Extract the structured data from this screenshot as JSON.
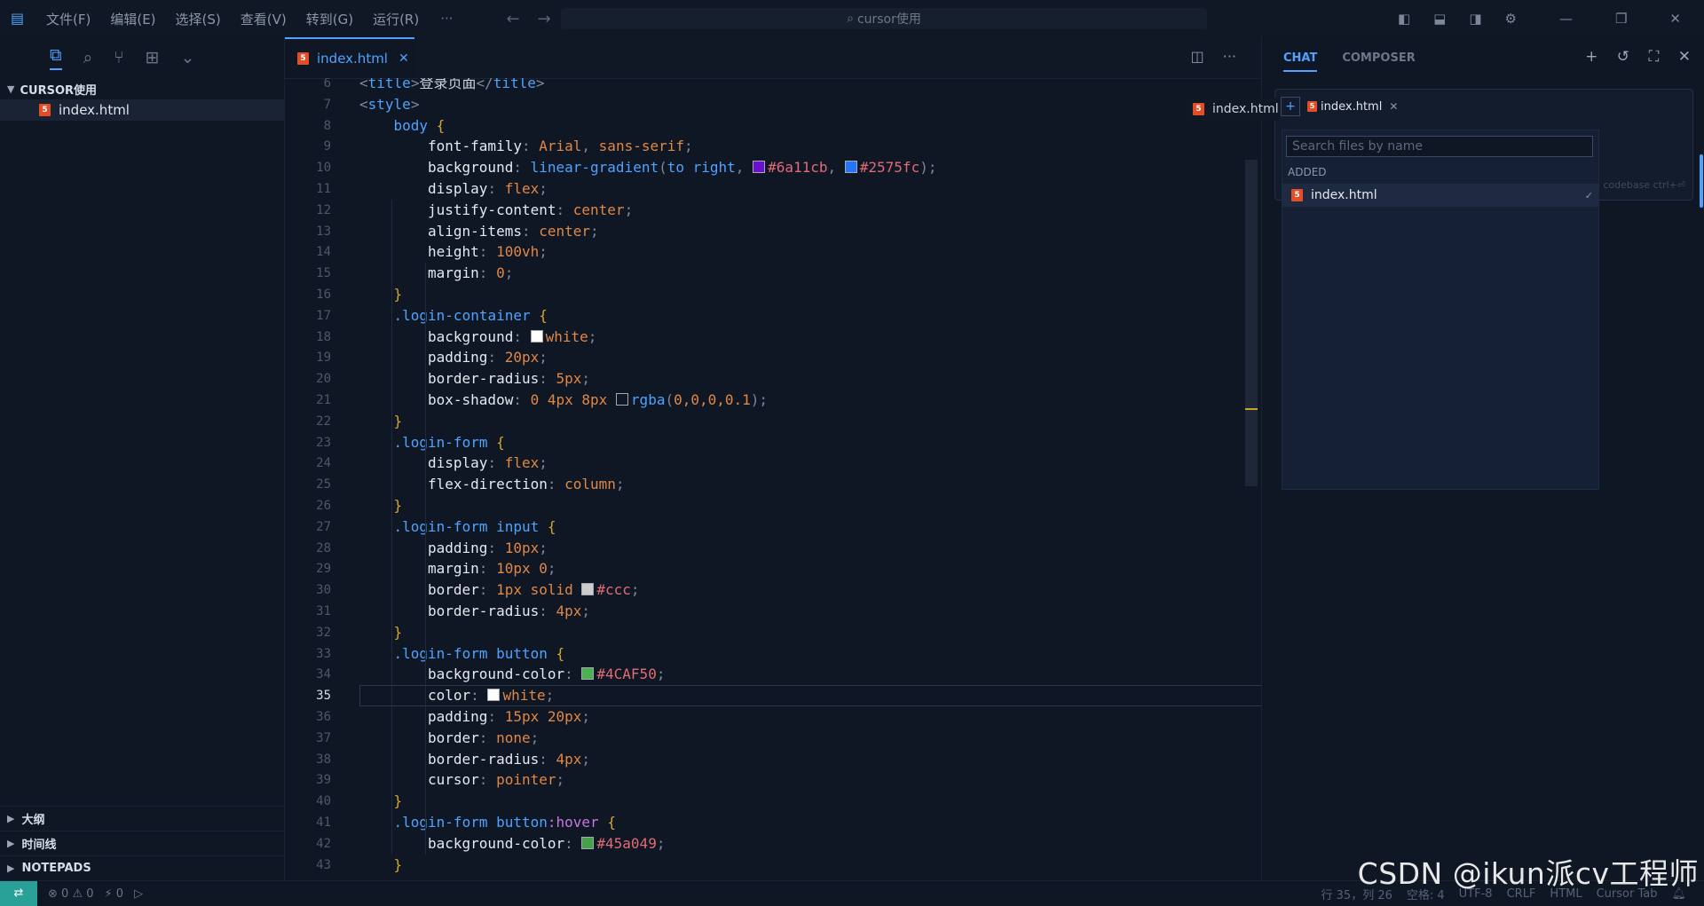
{
  "titlebar": {
    "menus": [
      "文件(F)",
      "编辑(E)",
      "选择(S)",
      "查看(V)",
      "转到(G)",
      "运行(R)"
    ],
    "more": "···",
    "search_text": "cursor使用"
  },
  "sidebar": {
    "folder": "CURSOR使用",
    "file": "index.html",
    "sections": [
      "大纲",
      "时间线",
      "NOTEPADS"
    ]
  },
  "editor": {
    "tab_label": "index.html",
    "current_line": 35
  },
  "code_lines": [
    {
      "n": "6",
      "parts": [
        [
          "tag",
          "<"
        ],
        [
          "tagname",
          "title"
        ],
        [
          "tag",
          ">"
        ],
        [
          "str",
          "登录页面"
        ],
        [
          "tag",
          "</"
        ],
        [
          "tagname",
          "title"
        ],
        [
          "tag",
          ">"
        ]
      ],
      "indent": 1
    },
    {
      "n": "7",
      "parts": [
        [
          "tag",
          "<"
        ],
        [
          "tagname",
          "style"
        ],
        [
          "tag",
          ">"
        ]
      ],
      "indent": 1
    },
    {
      "n": "8",
      "parts": [
        [
          "sel",
          "body"
        ],
        [
          "str",
          " "
        ],
        [
          "brace",
          "{"
        ]
      ],
      "indent": 2
    },
    {
      "n": "9",
      "parts": [
        [
          "prop",
          "font-family"
        ],
        [
          "punc",
          ": "
        ],
        [
          "val",
          "Arial"
        ],
        [
          "punc",
          ", "
        ],
        [
          "val",
          "sans-serif"
        ],
        [
          "punc",
          ";"
        ]
      ],
      "indent": 3
    },
    {
      "n": "10",
      "parts": [
        [
          "prop",
          "background"
        ],
        [
          "punc",
          ": "
        ],
        [
          "fn",
          "linear-gradient"
        ],
        [
          "punc",
          "("
        ],
        [
          "fn",
          "to right"
        ],
        [
          "punc",
          ", "
        ],
        [
          "swatch",
          "#6a11cb"
        ],
        [
          "hex",
          "#6a11cb"
        ],
        [
          "punc",
          ", "
        ],
        [
          "swatch",
          "#2575fc"
        ],
        [
          "hex",
          "#2575fc"
        ],
        [
          "punc",
          ");"
        ]
      ],
      "indent": 3
    },
    {
      "n": "11",
      "parts": [
        [
          "prop",
          "display"
        ],
        [
          "punc",
          ": "
        ],
        [
          "val",
          "flex"
        ],
        [
          "punc",
          ";"
        ]
      ],
      "indent": 3
    },
    {
      "n": "12",
      "parts": [
        [
          "prop",
          "justify-content"
        ],
        [
          "punc",
          ": "
        ],
        [
          "val",
          "center"
        ],
        [
          "punc",
          ";"
        ]
      ],
      "indent": 3
    },
    {
      "n": "13",
      "parts": [
        [
          "prop",
          "align-items"
        ],
        [
          "punc",
          ": "
        ],
        [
          "val",
          "center"
        ],
        [
          "punc",
          ";"
        ]
      ],
      "indent": 3
    },
    {
      "n": "14",
      "parts": [
        [
          "prop",
          "height"
        ],
        [
          "punc",
          ": "
        ],
        [
          "num",
          "100vh"
        ],
        [
          "punc",
          ";"
        ]
      ],
      "indent": 3
    },
    {
      "n": "15",
      "parts": [
        [
          "prop",
          "margin"
        ],
        [
          "punc",
          ": "
        ],
        [
          "num",
          "0"
        ],
        [
          "punc",
          ";"
        ]
      ],
      "indent": 3
    },
    {
      "n": "16",
      "parts": [
        [
          "brace",
          "}"
        ]
      ],
      "indent": 2
    },
    {
      "n": "17",
      "parts": [
        [
          "sel",
          ".login-container"
        ],
        [
          "str",
          " "
        ],
        [
          "brace",
          "{"
        ]
      ],
      "indent": 2
    },
    {
      "n": "18",
      "parts": [
        [
          "prop",
          "background"
        ],
        [
          "punc",
          ": "
        ],
        [
          "swatch",
          "#ffffff"
        ],
        [
          "val",
          "white"
        ],
        [
          "punc",
          ";"
        ]
      ],
      "indent": 3
    },
    {
      "n": "19",
      "parts": [
        [
          "prop",
          "padding"
        ],
        [
          "punc",
          ": "
        ],
        [
          "num",
          "20px"
        ],
        [
          "punc",
          ";"
        ]
      ],
      "indent": 3
    },
    {
      "n": "20",
      "parts": [
        [
          "prop",
          "border-radius"
        ],
        [
          "punc",
          ": "
        ],
        [
          "num",
          "5px"
        ],
        [
          "punc",
          ";"
        ]
      ],
      "indent": 3
    },
    {
      "n": "21",
      "parts": [
        [
          "prop",
          "box-shadow"
        ],
        [
          "punc",
          ": "
        ],
        [
          "num",
          "0 4px 8px "
        ],
        [
          "swatch",
          "#101826"
        ],
        [
          "fn",
          "rgba"
        ],
        [
          "punc",
          "("
        ],
        [
          "num",
          "0,0,0,0.1"
        ],
        [
          "punc",
          ");"
        ]
      ],
      "indent": 3
    },
    {
      "n": "22",
      "parts": [
        [
          "brace",
          "}"
        ]
      ],
      "indent": 2
    },
    {
      "n": "23",
      "parts": [
        [
          "sel",
          ".login-form"
        ],
        [
          "str",
          " "
        ],
        [
          "brace",
          "{"
        ]
      ],
      "indent": 2
    },
    {
      "n": "24",
      "parts": [
        [
          "prop",
          "display"
        ],
        [
          "punc",
          ": "
        ],
        [
          "val",
          "flex"
        ],
        [
          "punc",
          ";"
        ]
      ],
      "indent": 3
    },
    {
      "n": "25",
      "parts": [
        [
          "prop",
          "flex-direction"
        ],
        [
          "punc",
          ": "
        ],
        [
          "val",
          "column"
        ],
        [
          "punc",
          ";"
        ]
      ],
      "indent": 3
    },
    {
      "n": "26",
      "parts": [
        [
          "brace",
          "}"
        ]
      ],
      "indent": 2
    },
    {
      "n": "27",
      "parts": [
        [
          "sel",
          ".login-form input"
        ],
        [
          "str",
          " "
        ],
        [
          "brace",
          "{"
        ]
      ],
      "indent": 2
    },
    {
      "n": "28",
      "parts": [
        [
          "prop",
          "padding"
        ],
        [
          "punc",
          ": "
        ],
        [
          "num",
          "10px"
        ],
        [
          "punc",
          ";"
        ]
      ],
      "indent": 3
    },
    {
      "n": "29",
      "parts": [
        [
          "prop",
          "margin"
        ],
        [
          "punc",
          ": "
        ],
        [
          "num",
          "10px 0"
        ],
        [
          "punc",
          ";"
        ]
      ],
      "indent": 3
    },
    {
      "n": "30",
      "parts": [
        [
          "prop",
          "border"
        ],
        [
          "punc",
          ": "
        ],
        [
          "num",
          "1px solid "
        ],
        [
          "swatch",
          "#cccccc"
        ],
        [
          "hex",
          "#ccc"
        ],
        [
          "punc",
          ";"
        ]
      ],
      "indent": 3
    },
    {
      "n": "31",
      "parts": [
        [
          "prop",
          "border-radius"
        ],
        [
          "punc",
          ": "
        ],
        [
          "num",
          "4px"
        ],
        [
          "punc",
          ";"
        ]
      ],
      "indent": 3
    },
    {
      "n": "32",
      "parts": [
        [
          "brace",
          "}"
        ]
      ],
      "indent": 2
    },
    {
      "n": "33",
      "parts": [
        [
          "sel",
          ".login-form button"
        ],
        [
          "str",
          " "
        ],
        [
          "brace",
          "{"
        ]
      ],
      "indent": 2
    },
    {
      "n": "34",
      "parts": [
        [
          "prop",
          "background-color"
        ],
        [
          "punc",
          ": "
        ],
        [
          "swatch",
          "#4CAF50"
        ],
        [
          "hex",
          "#4CAF50"
        ],
        [
          "punc",
          ";"
        ]
      ],
      "indent": 3
    },
    {
      "n": "35",
      "parts": [
        [
          "prop",
          "color"
        ],
        [
          "punc",
          ": "
        ],
        [
          "swatch",
          "#ffffff"
        ],
        [
          "val",
          "white"
        ],
        [
          "punc",
          ";"
        ]
      ],
      "indent": 3
    },
    {
      "n": "36",
      "parts": [
        [
          "prop",
          "padding"
        ],
        [
          "punc",
          ": "
        ],
        [
          "num",
          "15px 20px"
        ],
        [
          "punc",
          ";"
        ]
      ],
      "indent": 3
    },
    {
      "n": "37",
      "parts": [
        [
          "prop",
          "border"
        ],
        [
          "punc",
          ": "
        ],
        [
          "val",
          "none"
        ],
        [
          "punc",
          ";"
        ]
      ],
      "indent": 3
    },
    {
      "n": "38",
      "parts": [
        [
          "prop",
          "border-radius"
        ],
        [
          "punc",
          ": "
        ],
        [
          "num",
          "4px"
        ],
        [
          "punc",
          ";"
        ]
      ],
      "indent": 3
    },
    {
      "n": "39",
      "parts": [
        [
          "prop",
          "cursor"
        ],
        [
          "punc",
          ": "
        ],
        [
          "val",
          "pointer"
        ],
        [
          "punc",
          ";"
        ]
      ],
      "indent": 3
    },
    {
      "n": "40",
      "parts": [
        [
          "brace",
          "}"
        ]
      ],
      "indent": 2
    },
    {
      "n": "41",
      "parts": [
        [
          "sel",
          ".login-form button"
        ],
        [
          "pseudo",
          ":hover"
        ],
        [
          "str",
          " "
        ],
        [
          "brace",
          "{"
        ]
      ],
      "indent": 2
    },
    {
      "n": "42",
      "parts": [
        [
          "prop",
          "background-color"
        ],
        [
          "punc",
          ": "
        ],
        [
          "swatch",
          "#45a049"
        ],
        [
          "hex",
          "#45a049"
        ],
        [
          "punc",
          ";"
        ]
      ],
      "indent": 3
    },
    {
      "n": "43",
      "parts": [
        [
          "brace",
          "}"
        ]
      ],
      "indent": 2
    }
  ],
  "chat": {
    "tabs": [
      "CHAT",
      "COMPOSER"
    ],
    "chip_label": "index.html",
    "search_placeholder": "Search files by name",
    "added_heading": "ADDED",
    "picker_item": "index.html",
    "hover_item": "index.html",
    "codebase_hint": "codebase ctrl+⏎"
  },
  "statusbar": {
    "errors": "0",
    "warnings": "0",
    "ports": "0",
    "position": "行 35，列 26",
    "spaces": "空格: 4",
    "encoding": "UTF-8",
    "eol": "CRLF",
    "language": "HTML",
    "cursor_tab": "Cursor Tab"
  },
  "watermark": "CSDN @ikun派cv工程师"
}
